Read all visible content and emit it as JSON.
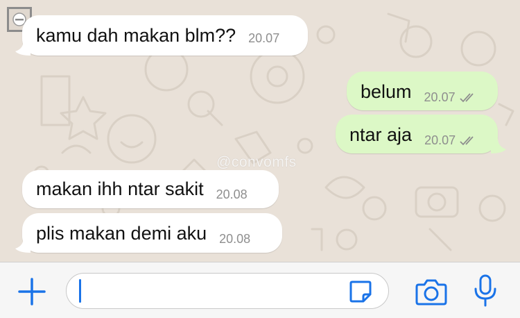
{
  "watermark": "@convomfs",
  "messages": [
    {
      "text": "kamu dah makan blm??",
      "time": "20.07",
      "direction": "incoming"
    },
    {
      "text": "belum",
      "time": "20.07",
      "direction": "outgoing",
      "status": "read"
    },
    {
      "text": "ntar aja",
      "time": "20.07",
      "direction": "outgoing",
      "status": "read"
    },
    {
      "text": "makan ihh ntar sakit",
      "time": "20.08",
      "direction": "incoming"
    },
    {
      "text": "plis makan demi aku",
      "time": "20.08",
      "direction": "incoming"
    }
  ],
  "input_bar": {
    "icons": [
      "plus-icon",
      "sticker-icon",
      "camera-icon",
      "microphone-icon"
    ],
    "accent": "#1a73e8"
  },
  "colors": {
    "incoming_bubble": "#ffffff",
    "outgoing_bubble": "#dcf8c6",
    "chat_background": "#e9e1d8"
  }
}
